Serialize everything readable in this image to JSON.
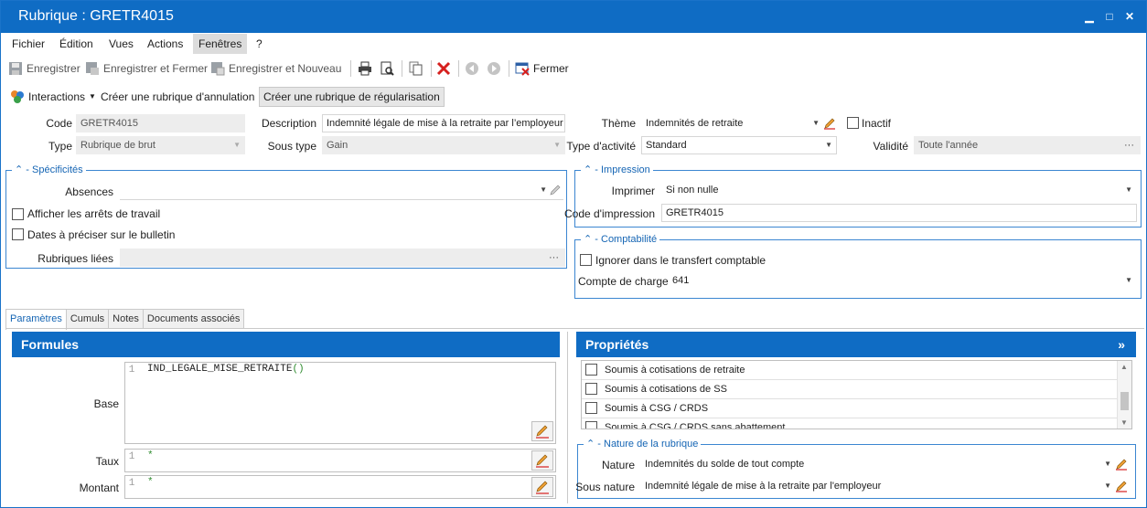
{
  "window": {
    "title": "Rubrique : GRETR4015",
    "controls": [
      "▁",
      "□",
      "✕"
    ]
  },
  "menu": [
    "Fichier",
    "Édition",
    "Vues",
    "Actions",
    "Fenêtres",
    "?"
  ],
  "toolbar": {
    "save": "Enregistrer",
    "save_close": "Enregistrer et Fermer",
    "save_new": "Enregistrer et Nouveau",
    "close": "Fermer"
  },
  "toolbar2": {
    "interactions": "Interactions",
    "cancel_rubric": "Créer une rubrique d'annulation",
    "regul_rubric": "Créer une rubrique de régularisation"
  },
  "form": {
    "code_label": "Code",
    "code": "GRETR4015",
    "type_label": "Type",
    "type": "Rubrique de brut",
    "description_label": "Description",
    "description": "Indemnité légale de mise à la retraite par l’employeur",
    "soustype_label": "Sous type",
    "soustype": "Gain",
    "theme_label": "Thème",
    "theme": "Indemnités de retraite",
    "typeactivite_label": "Type d'activité",
    "typeactivite": "Standard",
    "inactif_label": "Inactif",
    "validite_label": "Validité",
    "validite": "Toute l'année"
  },
  "specificites": {
    "title": "Spécificités",
    "absences_label": "Absences",
    "absences": "",
    "arrets_label": "Afficher les arrêts de travail",
    "dates_label": "Dates à préciser sur le bulletin",
    "rubriques_label": "Rubriques liées"
  },
  "impression": {
    "title": "Impression",
    "imprimer_label": "Imprimer",
    "imprimer": "Si non nulle",
    "code_label": "Code d'impression",
    "code": "GRETR4015"
  },
  "comptabilite": {
    "title": "Comptabilité",
    "ignorer_label": "Ignorer dans le transfert comptable",
    "compte_label": "Compte de charges",
    "compte": "641"
  },
  "tabs": [
    "Paramètres",
    "Cumuls",
    "Notes",
    "Documents associés"
  ],
  "formules": {
    "title": "Formules",
    "base_label": "Base",
    "base_line": "1",
    "base_code": "IND_LEGALE_MISE_RETRAITE",
    "taux_label": "Taux",
    "taux_line": "1",
    "taux_code": "*",
    "montant_label": "Montant",
    "montant_line": "1",
    "montant_code": "*"
  },
  "proprietes": {
    "title": "Propriétés",
    "expand": "»",
    "items": [
      "Soumis à cotisations de retraite",
      "Soumis à cotisations de SS",
      "Soumis à CSG / CRDS",
      "Soumis à CSG / CRDS sans abattement"
    ]
  },
  "nature": {
    "title": "Nature de la rubrique",
    "nature_label": "Nature",
    "nature": "Indemnités du solde de tout compte",
    "sousnature_label": "Sous nature",
    "sousnature": "Indemnité légale de mise à la retraite par l'employeur"
  },
  "colors": {
    "accent": "#0f6cc4",
    "group_border": "#3b86d1",
    "close_red": "#d6201e"
  }
}
